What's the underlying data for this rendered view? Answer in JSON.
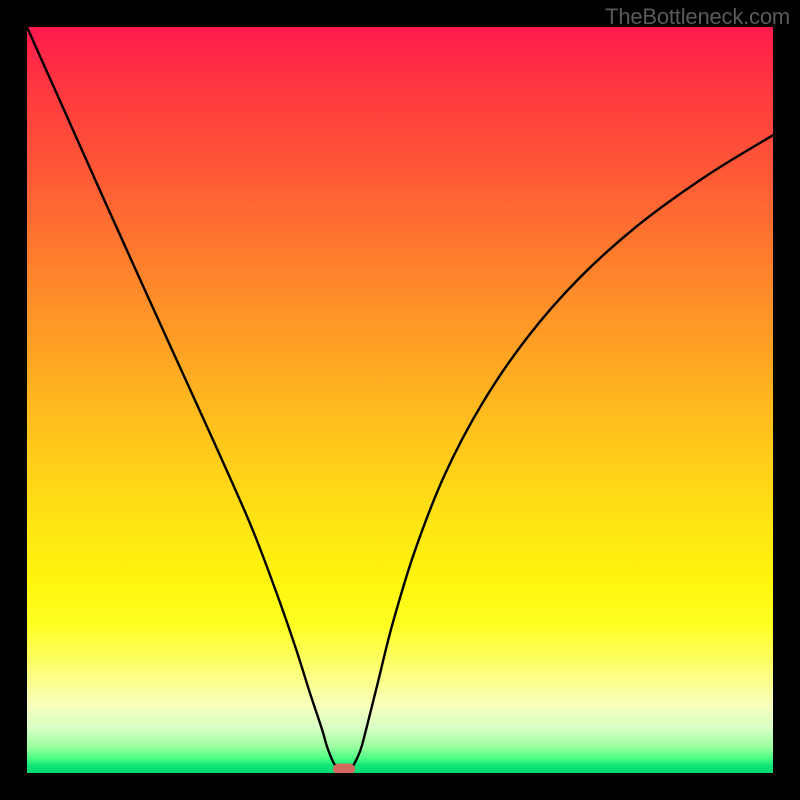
{
  "watermark": "TheBottleneck.com",
  "chart_data": {
    "type": "line",
    "title": "",
    "xlabel": "",
    "ylabel": "",
    "xlim": [
      0,
      1
    ],
    "ylim": [
      0,
      1
    ],
    "points": [
      {
        "x": 0.0,
        "y": 1.0
      },
      {
        "x": 0.05,
        "y": 0.888
      },
      {
        "x": 0.1,
        "y": 0.776
      },
      {
        "x": 0.15,
        "y": 0.665
      },
      {
        "x": 0.2,
        "y": 0.555
      },
      {
        "x": 0.25,
        "y": 0.445
      },
      {
        "x": 0.3,
        "y": 0.332
      },
      {
        "x": 0.335,
        "y": 0.24
      },
      {
        "x": 0.36,
        "y": 0.168
      },
      {
        "x": 0.38,
        "y": 0.105
      },
      {
        "x": 0.395,
        "y": 0.06
      },
      {
        "x": 0.403,
        "y": 0.033
      },
      {
        "x": 0.412,
        "y": 0.012
      },
      {
        "x": 0.423,
        "y": 0.002
      },
      {
        "x": 0.433,
        "y": 0.004
      },
      {
        "x": 0.446,
        "y": 0.028
      },
      {
        "x": 0.455,
        "y": 0.06
      },
      {
        "x": 0.47,
        "y": 0.12
      },
      {
        "x": 0.49,
        "y": 0.2
      },
      {
        "x": 0.52,
        "y": 0.298
      },
      {
        "x": 0.56,
        "y": 0.4
      },
      {
        "x": 0.61,
        "y": 0.495
      },
      {
        "x": 0.67,
        "y": 0.583
      },
      {
        "x": 0.74,
        "y": 0.663
      },
      {
        "x": 0.82,
        "y": 0.735
      },
      {
        "x": 0.91,
        "y": 0.8
      },
      {
        "x": 1.0,
        "y": 0.855
      }
    ],
    "marker": {
      "x": 0.425,
      "y": 0.005
    },
    "note": "Values are normalized to [0,1] read off the plot area; no axis ticks present in source image."
  },
  "colors": {
    "curve": "#000000",
    "marker": "#d36a60",
    "frame": "#000000"
  }
}
